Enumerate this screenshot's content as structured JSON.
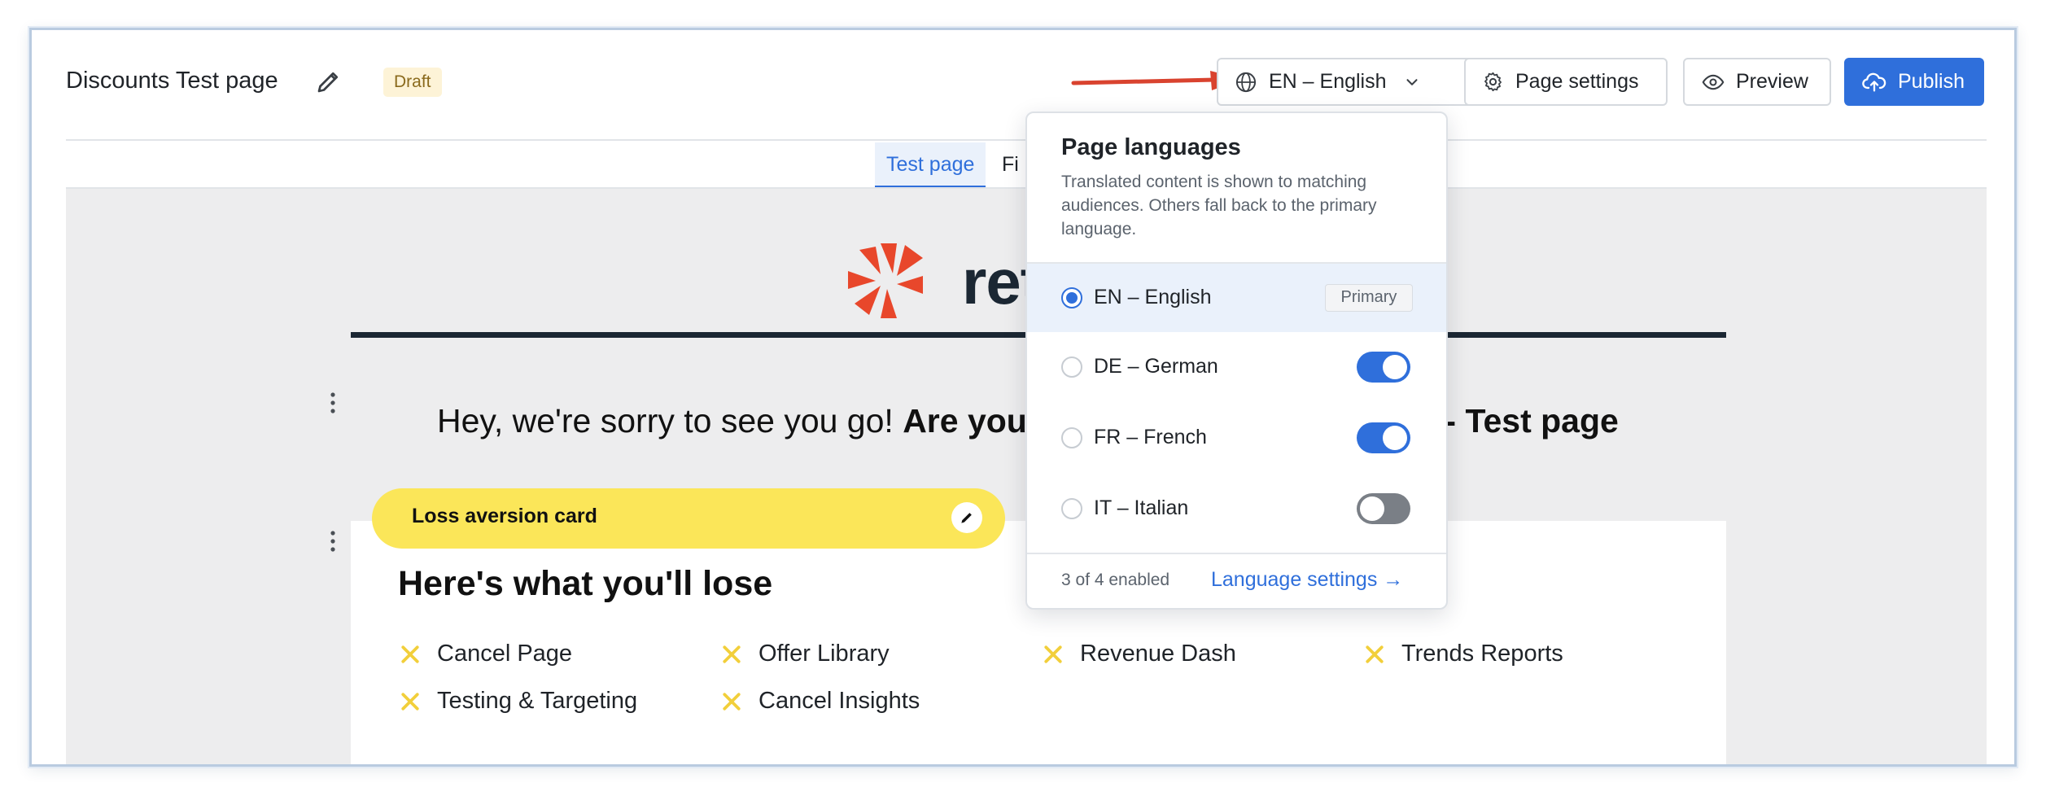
{
  "header": {
    "page_title": "Discounts Test page",
    "status_badge": "Draft",
    "language_button": "EN – English",
    "settings_button": "Page settings",
    "preview_button": "Preview",
    "publish_button": "Publish"
  },
  "tabs": [
    {
      "label": "Test page",
      "active": true
    },
    {
      "label": "Fi",
      "active": false
    }
  ],
  "canvas": {
    "logo_text": "ret",
    "headline_start": "Hey, we're sorry to see you go! ",
    "headline_bold": "Are you",
    "headline_end": "? - Test page",
    "card": {
      "label": "Loss aversion card",
      "heading": "Here's what you'll lose",
      "features": [
        "Cancel Page",
        "Offer Library",
        "Revenue Dash",
        "Trends Reports",
        "Testing & Targeting",
        "Cancel Insights"
      ]
    }
  },
  "language_dropdown": {
    "title": "Page languages",
    "description": "Translated content is shown to matching audiences. Others fall back to the primary language.",
    "languages": [
      {
        "label": "EN – English",
        "selected": true,
        "badge": "Primary"
      },
      {
        "label": "DE – German",
        "selected": false,
        "enabled": true
      },
      {
        "label": "FR – French",
        "selected": false,
        "enabled": true
      },
      {
        "label": "IT – Italian",
        "selected": false,
        "enabled": false
      }
    ],
    "enabled_count": "3 of 4 enabled",
    "settings_link": "Language settings →"
  },
  "colors": {
    "primary_blue": "#2f6fdb",
    "draft_badge_bg": "#fdf3d7",
    "card_pill_yellow": "#fbe659",
    "logo_red": "#e8472b",
    "annotation_arrow": "#d9432f"
  },
  "icons": [
    "pencil-icon",
    "globe-icon",
    "chevron-down-icon",
    "gear-icon",
    "eye-icon",
    "cloud-upload-icon",
    "kebab-menu-icon",
    "x-mark-icon",
    "arrow-right-icon"
  ]
}
